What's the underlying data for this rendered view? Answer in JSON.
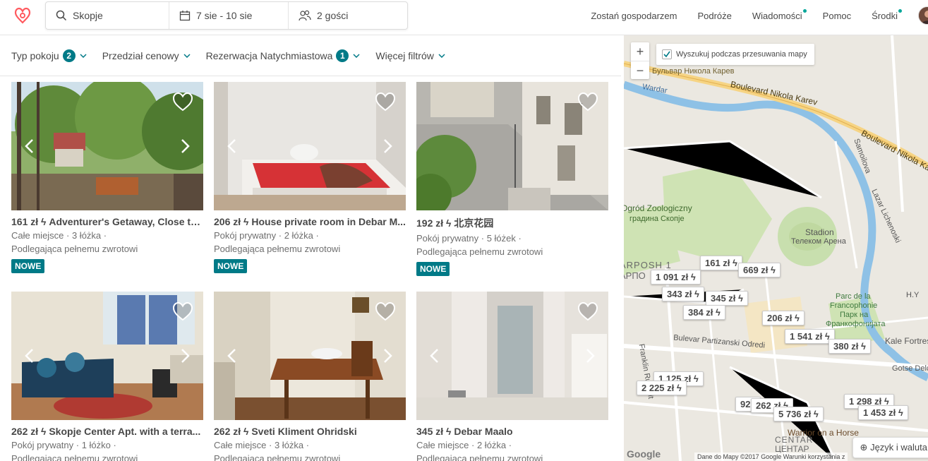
{
  "search": {
    "location": "Skopje",
    "dates": "7 sie - 10 sie",
    "guests": "2 gości"
  },
  "nav": {
    "host": "Zostań gospodarzem",
    "trips": "Podróże",
    "messages": "Wiadomości",
    "help": "Pomoc",
    "credits": "Środki"
  },
  "filters": {
    "room_type": "Typ pokoju",
    "room_type_count": "2",
    "price": "Przedział cenowy",
    "instant": "Rezerwacja Natychmiastowa",
    "instant_count": "1",
    "more": "Więcej filtrów"
  },
  "listings": [
    {
      "price": "161 zł",
      "name": "Adventurer's Getaway, Close to ...",
      "line1": "Całe miejsce · 3 łóżka ·",
      "line2": "Podlegająca pełnemu zwrotowi",
      "badge": "NOWE"
    },
    {
      "price": "206 zł",
      "name": "House private room in Debar M...",
      "line1": "Pokój prywatny · 2 łóżka ·",
      "line2": "Podlegająca pełnemu zwrotowi",
      "badge": "NOWE"
    },
    {
      "price": "192 zł",
      "name": "北京花园",
      "line1": "Pokój prywatny · 5 łóżek ·",
      "line2": "Podlegająca pełnemu zwrotowi",
      "badge": "NOWE"
    },
    {
      "price": "262 zł",
      "name": "Skopje Center Apt. with a terra...",
      "line1": "Pokój prywatny · 1 łóżko ·",
      "line2": "Podlegająca pełnemu zwrotowi",
      "badge": ""
    },
    {
      "price": "262 zł",
      "name": "Sveti Kliment Ohridski",
      "line1": "Całe miejsce · 3 łóżka ·",
      "line2": "Podlegająca pełnemu zwrotowi",
      "badge": ""
    },
    {
      "price": "345 zł",
      "name": "Debar Maalo",
      "line1": "Całe miejsce · 2 łóżka ·",
      "line2": "Podlegająca pełnemu zwrotowi",
      "badge": ""
    }
  ],
  "map": {
    "search_toggle": "Wyszukuj podczas przesuwania mapy",
    "language": "Język i waluta",
    "attribution": "Dane do Mapy ©2017 Google    Warunki korzystania z",
    "google": "Google",
    "labels": {
      "boulevard1": "Boulevard Nikola Karev",
      "boulevard2": "Бульвар Никола Карев",
      "wardar": "Wardar",
      "zoo1": "Ogród Zoologiczny",
      "zoo2": "градина Скопје",
      "stadion": "Stadion",
      "arena": "Телеком Арена",
      "park1": "Parc de la",
      "park2": "Francophonie",
      "park3": "Парк на",
      "park4": "Франкофонијата",
      "partizanski": "Bulevar Partizanski Odredi",
      "kale": "Kale Fortress",
      "gotse": "Gotse Delc",
      "warrior": "Warrior on a Horse",
      "centar": "CENTAR",
      "centar2": "ЦЕНТАР",
      "karpos": "ARPOSH 1",
      "karpos2": "АРПО",
      "samoilova": "Samoilova",
      "lichenoski": "Lazar Lichenoski",
      "franklin": "Franklin Ruzvelt",
      "hy": "H.Y"
    },
    "pins": [
      "161 zł",
      "669 zł",
      "1 091 zł",
      "343 zł",
      "345 zł",
      "384 zł",
      "206 zł",
      "1 541 zł",
      "380 zł",
      "1 125 zł",
      "2 225 zł",
      "921",
      "262 zł",
      "5 736 zł",
      "1 298 zł",
      "1 453 zł"
    ]
  }
}
